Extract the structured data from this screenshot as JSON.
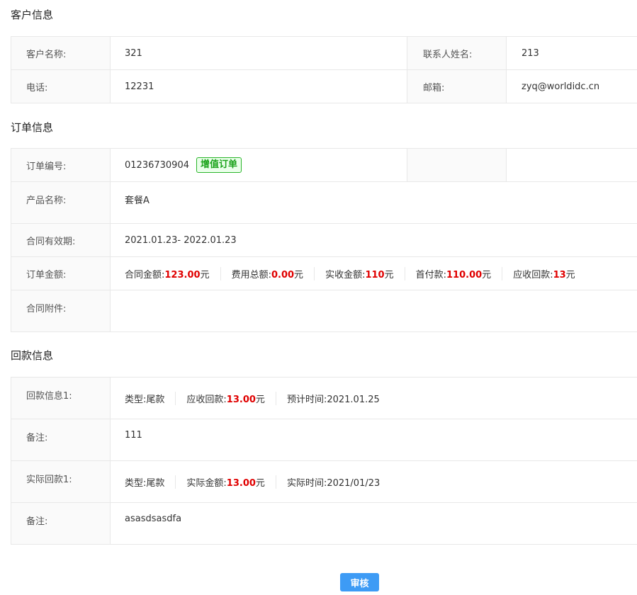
{
  "customer": {
    "title": "客户信息",
    "name_label": "客户名称:",
    "name_value": "321",
    "contact_label": "联系人姓名:",
    "contact_value": "213",
    "phone_label": "电话:",
    "phone_value": "12231",
    "email_label": "邮箱:",
    "email_value": "zyq@worldidc.cn"
  },
  "order": {
    "title": "订单信息",
    "number_label": "订单编号:",
    "number_value": "01236730904",
    "tag": "增值订单",
    "product_label": "产品名称:",
    "product_value": "套餐A",
    "validity_label": "合同有效期:",
    "validity_value": "2021.01.23- 2022.01.23",
    "amount_label": "订单金额:",
    "amounts": [
      {
        "label": "合同金额:",
        "value": "123.00",
        "unit": "元"
      },
      {
        "label": "费用总额:",
        "value": "0.00",
        "unit": "元"
      },
      {
        "label": "实收金额:",
        "value": "110",
        "unit": "元"
      },
      {
        "label": "首付款:",
        "value": "110.00",
        "unit": "元"
      },
      {
        "label": "应收回款:",
        "value": "13",
        "unit": "元"
      }
    ],
    "attachment_label": "合同附件:"
  },
  "payment": {
    "title": "回款信息",
    "info_label": "回款信息1:",
    "info": {
      "type_label": "类型:",
      "type_value": "尾款",
      "due_label": "应收回款:",
      "due_value": "13.00",
      "due_unit": "元",
      "time_label": "预计时间:",
      "time_value": "2021.01.25"
    },
    "note1_label": "备注:",
    "note1_value": "111",
    "actual_label": "实际回款1:",
    "actual": {
      "type_label": "类型:",
      "type_value": "尾款",
      "amount_label": "实际金额:",
      "amount_value": "13.00",
      "amount_unit": "元",
      "time_label": "实际时间:",
      "time_value": "2021/01/23"
    },
    "note2_label": "备注:",
    "note2_value": "asasdsasdfa"
  },
  "actions": {
    "review_label": "审核"
  },
  "colors": {
    "accent": "#3d9bf5",
    "highlight": "#e00000",
    "tag": "#1aa31a"
  }
}
